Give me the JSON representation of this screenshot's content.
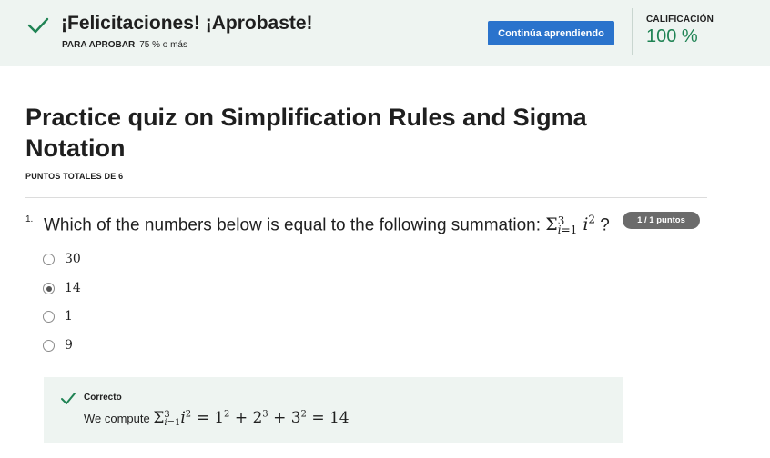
{
  "banner": {
    "title": "¡Felicitaciones! ¡Aprobaste!",
    "pass_label": "PARA APROBAR",
    "pass_value": "75 % o más",
    "continue_label": "Continúa aprendiendo",
    "grade_label": "CALIFICACIÓN",
    "grade_value": "100 %",
    "accent_color": "#1f8354",
    "button_color": "#2a73cc"
  },
  "quiz": {
    "title": "Practice quiz on Simplification Rules and Sigma Notation",
    "points_total": "PUNTOS TOTALES DE 6"
  },
  "question": {
    "number": "1.",
    "text": "Which of the numbers below is equal to the following summation:",
    "badge": "1 / 1 puntos",
    "options": [
      {
        "label": "30",
        "selected": false
      },
      {
        "label": "14",
        "selected": true
      },
      {
        "label": "1",
        "selected": false
      },
      {
        "label": "9",
        "selected": false
      }
    ]
  },
  "feedback": {
    "title": "Correcto",
    "text": "We compute"
  }
}
